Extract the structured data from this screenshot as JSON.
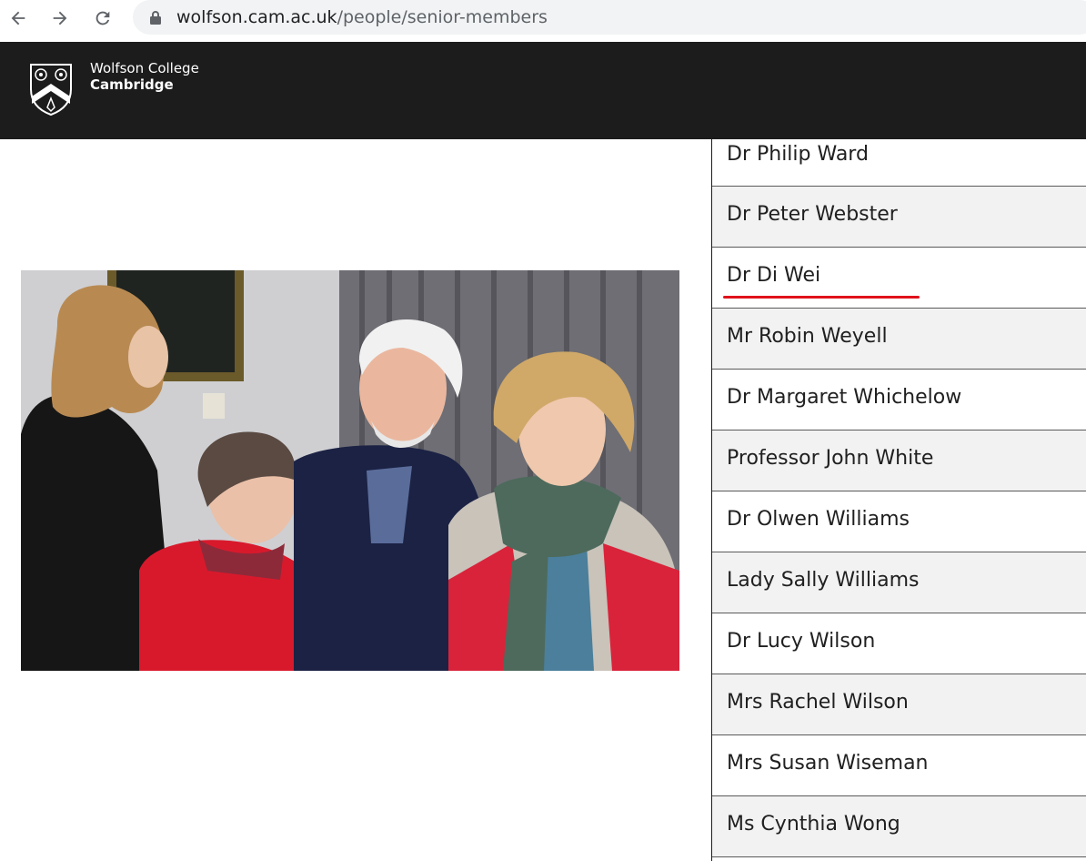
{
  "browser": {
    "url_domain": "wolfson.cam.ac.uk",
    "url_path": "/people/senior-members"
  },
  "header": {
    "brand_line1": "Wolfson College",
    "brand_line2": "Cambridge"
  },
  "members": [
    {
      "name": "Dr Philip Ward"
    },
    {
      "name": "Dr Peter Webster"
    },
    {
      "name": "Dr Di Wei"
    },
    {
      "name": "Mr Robin Weyell"
    },
    {
      "name": "Dr Margaret Whichelow"
    },
    {
      "name": "Professor John White"
    },
    {
      "name": "Dr Olwen Williams"
    },
    {
      "name": "Lady Sally Williams"
    },
    {
      "name": "Dr Lucy Wilson"
    },
    {
      "name": "Mrs Rachel Wilson"
    },
    {
      "name": "Mrs Susan Wiseman"
    },
    {
      "name": "Ms Cynthia Wong"
    }
  ],
  "colors": {
    "header_bg": "#1c1c1c",
    "row_alt_bg": "#f2f2f2",
    "highlight_underline": "#e0121b"
  }
}
